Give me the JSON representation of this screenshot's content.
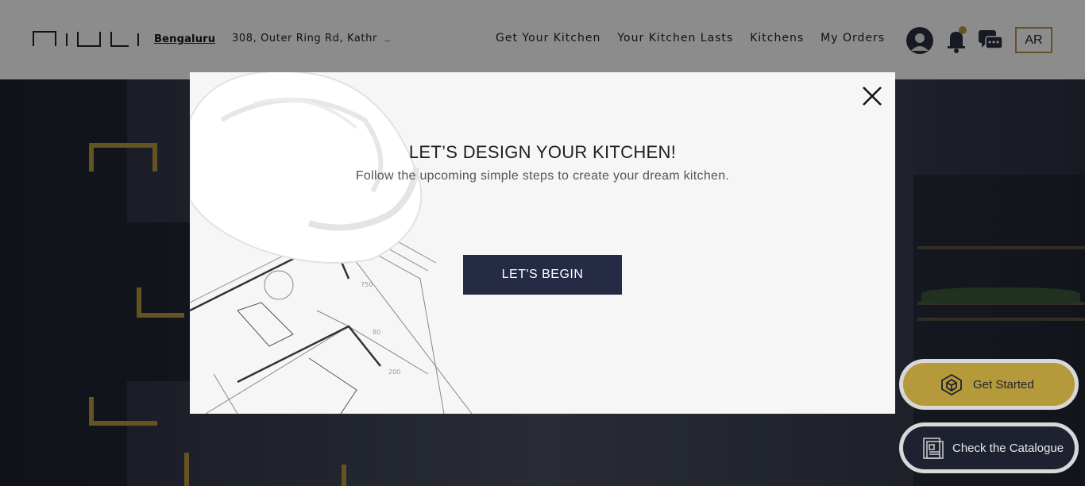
{
  "header": {
    "logo_text": "niuli",
    "city": "Bengaluru",
    "address": "308, Outer Ring Rd, Kathr",
    "nav": [
      "Get Your Kitchen",
      "Your Kitchen Lasts",
      "Kitchens",
      "My Orders"
    ],
    "ar_label": "AR"
  },
  "icons": {
    "address_dropdown": "chevron-down-icon",
    "account": "user-avatar-icon",
    "notifications": "bell-icon",
    "messages": "chat-icon",
    "close": "close-icon",
    "get_started": "cube-icon",
    "catalogue": "catalogue-icon"
  },
  "colors": {
    "accent": "#b59a3c",
    "navy": "#262b45",
    "dark": "#1e2230"
  },
  "modal": {
    "title": "LET’S DESIGN YOUR KITCHEN!",
    "subtitle": "Follow the upcoming simple steps to create your dream kitchen.",
    "button": "LET'S BEGIN"
  },
  "floating": {
    "get_started": "Get Started",
    "catalogue": "Check the Catalogue"
  }
}
